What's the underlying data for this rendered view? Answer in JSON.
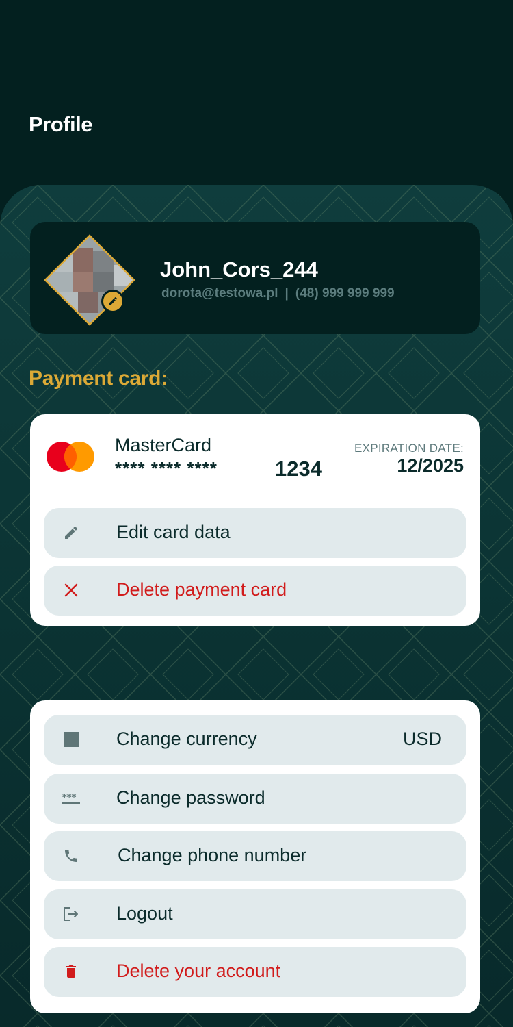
{
  "header": {
    "title": "Profile"
  },
  "profile": {
    "username": "John_Cors_244",
    "email": "dorota@testowa.pl",
    "separator": "|",
    "phone": "(48) 999 999 999"
  },
  "payment": {
    "section_title": "Payment card:",
    "card": {
      "brand": "MasterCard",
      "masked_number": "**** **** ****",
      "last4": "1234",
      "expiration_label": "EXPIRATION DATE:",
      "expiration_value": "12/2025"
    },
    "actions": [
      {
        "label": "Edit card data",
        "icon": "pencil-icon"
      },
      {
        "label": "Delete payment card",
        "icon": "close-icon"
      }
    ]
  },
  "settings": {
    "items": [
      {
        "label": "Change currency",
        "value": "USD",
        "icon": "currency-square-icon"
      },
      {
        "label": "Change password",
        "icon": "password-icon"
      },
      {
        "label": "Change phone number",
        "icon": "phone-icon"
      },
      {
        "label": "Logout",
        "icon": "logout-icon"
      },
      {
        "label": "Delete your account",
        "icon": "trash-icon"
      }
    ]
  },
  "colors": {
    "background": "#03201f",
    "accent_gold": "#dca936",
    "danger_red": "#d11c1c",
    "row_bg": "#e1eaec",
    "text_dark": "#0b2b2b",
    "muted_teal": "#5c7d7e"
  }
}
